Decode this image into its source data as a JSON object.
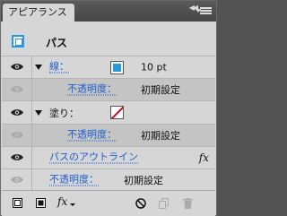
{
  "tab": {
    "label": "アピアランス"
  },
  "header": {
    "title": "パス"
  },
  "rows": {
    "stroke": {
      "label": "線：",
      "value": "10 pt",
      "swatch_color": "#2a9ae0"
    },
    "stroke_opacity": {
      "label": "不透明度：",
      "value": "初期設定"
    },
    "fill": {
      "label": "塗り：",
      "swatch": "none"
    },
    "fill_opacity": {
      "label": "不透明度：",
      "value": "初期設定"
    },
    "effect": {
      "label": "パスのアウトライン",
      "fx": "fx"
    },
    "opacity": {
      "label": "不透明度：",
      "value": "初期設定"
    }
  },
  "footer": {
    "icons": [
      "add-new-stroke-icon",
      "add-new-fill-icon",
      "add-new-effect-icon",
      "clear-appearance-icon",
      "duplicate-item-icon",
      "delete-item-icon"
    ],
    "fx_label": "fx"
  },
  "colors": {
    "accent": "#2a9ae0",
    "link": "#1f5fd0",
    "panel": "#d6d6d6"
  }
}
